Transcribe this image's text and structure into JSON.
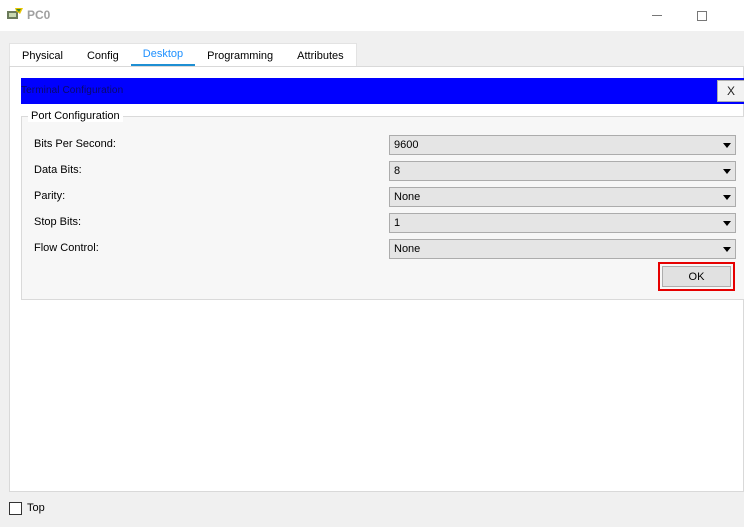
{
  "window": {
    "title": "PC0",
    "minimize_icon": "minimize-icon",
    "maximize_icon": "maximize-icon"
  },
  "tabs": [
    {
      "label": "Physical",
      "active": false
    },
    {
      "label": "Config",
      "active": false
    },
    {
      "label": "Desktop",
      "active": true
    },
    {
      "label": "Programming",
      "active": false
    },
    {
      "label": "Attributes",
      "active": false
    }
  ],
  "terminal_config": {
    "title": "Terminal Configuration",
    "close_label": "X",
    "header_color": "#0000ff",
    "port_config": {
      "legend": "Port Configuration",
      "fields": [
        {
          "label": "Bits Per Second:",
          "value": "9600"
        },
        {
          "label": "Data Bits:",
          "value": "8"
        },
        {
          "label": "Parity:",
          "value": "None"
        },
        {
          "label": "Stop Bits:",
          "value": "1"
        },
        {
          "label": "Flow Control:",
          "value": "None"
        }
      ]
    },
    "ok_label": "OK",
    "ok_highlight_color": "#e60000"
  },
  "footer": {
    "top_label": "Top",
    "top_checked": false
  }
}
